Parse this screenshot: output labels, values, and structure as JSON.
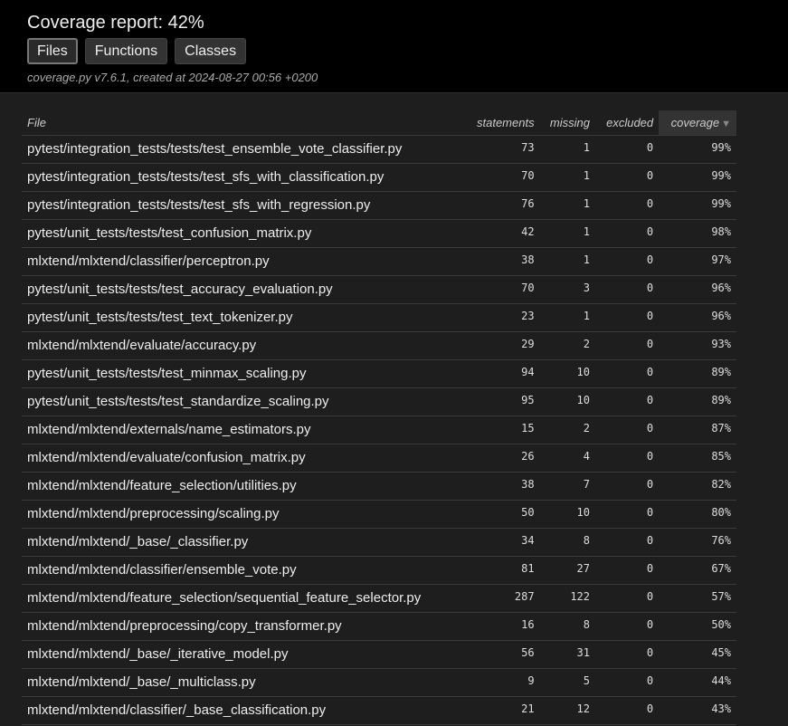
{
  "header": {
    "title": "Coverage report: 42%",
    "tabs": [
      {
        "label": "Files",
        "current": true
      },
      {
        "label": "Functions",
        "current": false
      },
      {
        "label": "Classes",
        "current": false
      }
    ],
    "meta": "coverage.py v7.6.1, created at 2024-08-27 00:56 +0200"
  },
  "table": {
    "columns": {
      "file": "File",
      "statements": "statements",
      "missing": "missing",
      "excluded": "excluded",
      "coverage": "coverage",
      "sort_indicator": "▼"
    },
    "rows": [
      {
        "file": "pytest/integration_tests/tests/test_ensemble_vote_classifier.py",
        "statements": "73",
        "missing": "1",
        "excluded": "0",
        "coverage": "99%"
      },
      {
        "file": "pytest/integration_tests/tests/test_sfs_with_classification.py",
        "statements": "70",
        "missing": "1",
        "excluded": "0",
        "coverage": "99%"
      },
      {
        "file": "pytest/integration_tests/tests/test_sfs_with_regression.py",
        "statements": "76",
        "missing": "1",
        "excluded": "0",
        "coverage": "99%"
      },
      {
        "file": "pytest/unit_tests/tests/test_confusion_matrix.py",
        "statements": "42",
        "missing": "1",
        "excluded": "0",
        "coverage": "98%"
      },
      {
        "file": "mlxtend/mlxtend/classifier/perceptron.py",
        "statements": "38",
        "missing": "1",
        "excluded": "0",
        "coverage": "97%"
      },
      {
        "file": "pytest/unit_tests/tests/test_accuracy_evaluation.py",
        "statements": "70",
        "missing": "3",
        "excluded": "0",
        "coverage": "96%"
      },
      {
        "file": "pytest/unit_tests/tests/test_text_tokenizer.py",
        "statements": "23",
        "missing": "1",
        "excluded": "0",
        "coverage": "96%"
      },
      {
        "file": "mlxtend/mlxtend/evaluate/accuracy.py",
        "statements": "29",
        "missing": "2",
        "excluded": "0",
        "coverage": "93%"
      },
      {
        "file": "pytest/unit_tests/tests/test_minmax_scaling.py",
        "statements": "94",
        "missing": "10",
        "excluded": "0",
        "coverage": "89%"
      },
      {
        "file": "pytest/unit_tests/tests/test_standardize_scaling.py",
        "statements": "95",
        "missing": "10",
        "excluded": "0",
        "coverage": "89%"
      },
      {
        "file": "mlxtend/mlxtend/externals/name_estimators.py",
        "statements": "15",
        "missing": "2",
        "excluded": "0",
        "coverage": "87%"
      },
      {
        "file": "mlxtend/mlxtend/evaluate/confusion_matrix.py",
        "statements": "26",
        "missing": "4",
        "excluded": "0",
        "coverage": "85%"
      },
      {
        "file": "mlxtend/mlxtend/feature_selection/utilities.py",
        "statements": "38",
        "missing": "7",
        "excluded": "0",
        "coverage": "82%"
      },
      {
        "file": "mlxtend/mlxtend/preprocessing/scaling.py",
        "statements": "50",
        "missing": "10",
        "excluded": "0",
        "coverage": "80%"
      },
      {
        "file": "mlxtend/mlxtend/_base/_classifier.py",
        "statements": "34",
        "missing": "8",
        "excluded": "0",
        "coverage": "76%"
      },
      {
        "file": "mlxtend/mlxtend/classifier/ensemble_vote.py",
        "statements": "81",
        "missing": "27",
        "excluded": "0",
        "coverage": "67%"
      },
      {
        "file": "mlxtend/mlxtend/feature_selection/sequential_feature_selector.py",
        "statements": "287",
        "missing": "122",
        "excluded": "0",
        "coverage": "57%"
      },
      {
        "file": "mlxtend/mlxtend/preprocessing/copy_transformer.py",
        "statements": "16",
        "missing": "8",
        "excluded": "0",
        "coverage": "50%"
      },
      {
        "file": "mlxtend/mlxtend/_base/_iterative_model.py",
        "statements": "56",
        "missing": "31",
        "excluded": "0",
        "coverage": "45%"
      },
      {
        "file": "mlxtend/mlxtend/_base/_multiclass.py",
        "statements": "9",
        "missing": "5",
        "excluded": "0",
        "coverage": "44%"
      },
      {
        "file": "mlxtend/mlxtend/classifier/_base_classification.py",
        "statements": "21",
        "missing": "12",
        "excluded": "0",
        "coverage": "43%"
      },
      {
        "file": "",
        "statements": "",
        "missing": "",
        "excluded": "",
        "coverage": ""
      }
    ]
  }
}
